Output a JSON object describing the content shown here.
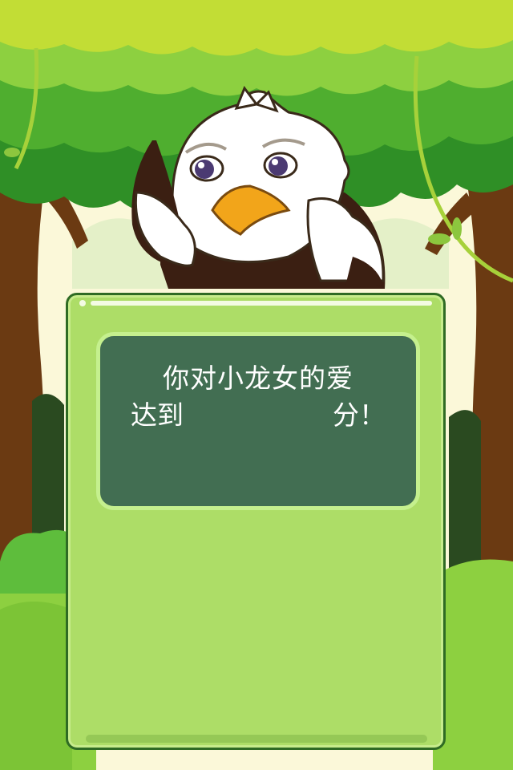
{
  "result_panel": {
    "message_line1": "你对小龙女的爱",
    "message_prefix": "达到",
    "score": "",
    "message_suffix": "分！"
  },
  "colors": {
    "panel": "#addd67",
    "panel_border": "#2f6b24",
    "board": "#426e52",
    "board_border": "#c5f08e",
    "foliage_dark": "#2f8f26",
    "foliage_light": "#8dd040",
    "trunk": "#6b3a12",
    "beak": "#f2a51a"
  },
  "icons": {
    "character": "eagle-mascot",
    "decor": [
      "tree-left-icon",
      "tree-right-icon",
      "vine-icon",
      "bush-icon"
    ]
  }
}
